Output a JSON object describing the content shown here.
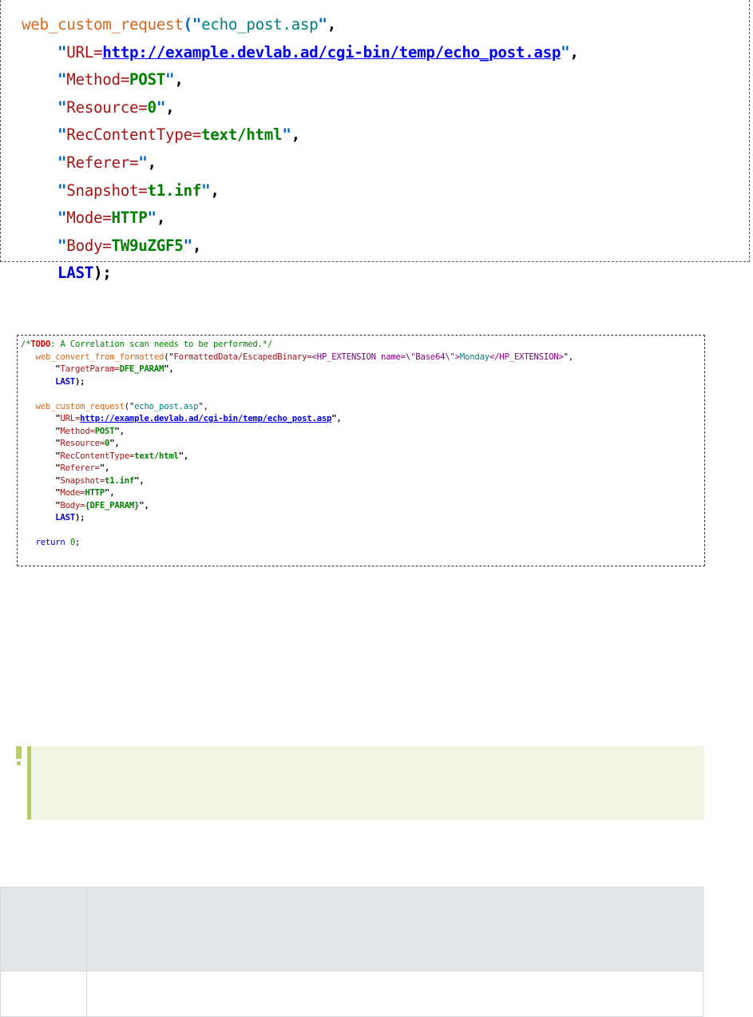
{
  "snippet_recorded": {
    "function": "web_custom_request",
    "request_name": "echo_post.asp",
    "url_key": "URL=",
    "url": "http://example.devlab.ad/cgi-bin/temp/echo_post.asp",
    "method_key": "Method=",
    "method": "POST",
    "resource_key": "Resource=",
    "resource": "0",
    "rct_key": "RecContentType=",
    "rct": "text/html",
    "referer_key": "Referer=",
    "snapshot_key": "Snapshot=",
    "snapshot": "t1.inf",
    "mode_key": "Mode=",
    "mode": "HTTP",
    "body_key": "Body=",
    "body": "TW9uZGF5",
    "last": "LAST"
  },
  "snippet_converted": {
    "comment_open": "/*",
    "todo": "TODO",
    "comment_text": ": A Correlation scan needs to be performed.*/",
    "convert_function": "web_convert_from_formatted",
    "formatted_prefix": "FormattedData/EscapedBinary=",
    "ext_open": "<HP_EXTENSION name=\\\"Base64\\\">",
    "ext_value": "Monday",
    "ext_close": "</HP_EXTENSION>",
    "target_key": "TargetParam=",
    "target_value": "DFE_PARAM",
    "last": "LAST",
    "function": "web_custom_request",
    "request_name": "echo_post.asp",
    "url_key": "URL=",
    "url": "http://example.devlab.ad/cgi-bin/temp/echo_post.asp",
    "method_key": "Method=",
    "method": "POST",
    "resource_key": "Resource=",
    "resource": "0",
    "rct_key": "RecContentType=",
    "rct": "text/html",
    "referer_key": "Referer=",
    "snapshot_key": "Snapshot=",
    "snapshot": "t1.inf",
    "mode_key": "Mode=",
    "mode": "HTTP",
    "body_key": "Body=",
    "body": "{DFE_PARAM}",
    "return_kw": "return",
    "return_value": "0"
  },
  "colors": {
    "tip_background": "#f1f5e4",
    "tip_accent": "#b6cc6e",
    "table_header": "#e3e6e8",
    "table_border": "#d6dadd"
  },
  "icons": {
    "tip": "exclamation-icon"
  }
}
